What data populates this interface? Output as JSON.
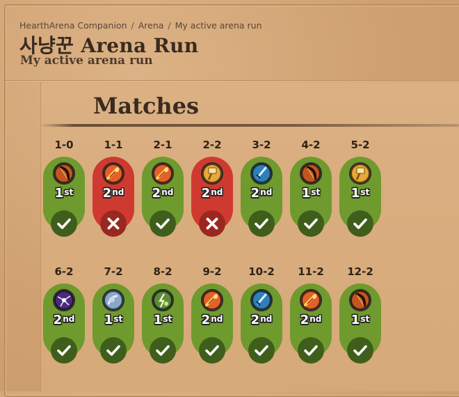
{
  "breadcrumb": [
    "HearthArena Companion",
    "Arena",
    "My active arena run"
  ],
  "header": {
    "title": "사냥꾼 Arena Run",
    "subtitle": "My active arena run"
  },
  "matches_section": {
    "title": "Matches"
  },
  "colors": {
    "win": "#6f9a2e",
    "loss": "#cf3a30"
  },
  "matches": [
    {
      "score": "1-0",
      "place": "1",
      "suffix": "st",
      "result": "win",
      "hero": "hunter-bow-icon"
    },
    {
      "score": "1-1",
      "place": "2",
      "suffix": "nd",
      "result": "loss",
      "hero": "fire-icon"
    },
    {
      "score": "2-1",
      "place": "2",
      "suffix": "nd",
      "result": "win",
      "hero": "fire-icon"
    },
    {
      "score": "2-2",
      "place": "2",
      "suffix": "nd",
      "result": "loss",
      "hero": "paladin-hammer-icon"
    },
    {
      "score": "3-2",
      "place": "2",
      "suffix": "nd",
      "result": "win",
      "hero": "warrior-sword-icon"
    },
    {
      "score": "4-2",
      "place": "1",
      "suffix": "st",
      "result": "win",
      "hero": "hunter-bow-icon"
    },
    {
      "score": "5-2",
      "place": "1",
      "suffix": "st",
      "result": "win",
      "hero": "paladin-hammer-icon"
    },
    {
      "score": "6-2",
      "place": "2",
      "suffix": "nd",
      "result": "win",
      "hero": "warlock-fel-icon"
    },
    {
      "score": "7-2",
      "place": "1",
      "suffix": "st",
      "result": "win",
      "hero": "mage-orb-icon"
    },
    {
      "score": "8-2",
      "place": "1",
      "suffix": "st",
      "result": "win",
      "hero": "shaman-lightning-icon"
    },
    {
      "score": "9-2",
      "place": "2",
      "suffix": "nd",
      "result": "win",
      "hero": "fire-icon"
    },
    {
      "score": "10-2",
      "place": "2",
      "suffix": "nd",
      "result": "win",
      "hero": "warrior-sword-icon"
    },
    {
      "score": "11-2",
      "place": "2",
      "suffix": "nd",
      "result": "win",
      "hero": "fire-icon"
    },
    {
      "score": "12-2",
      "place": "1",
      "suffix": "st",
      "result": "win",
      "hero": "hunter-bow-icon"
    }
  ]
}
